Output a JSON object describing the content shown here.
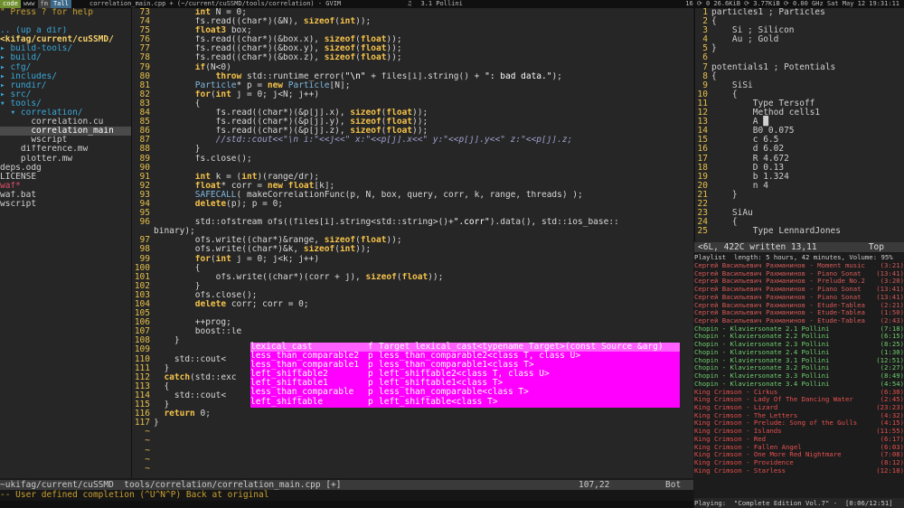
{
  "topbar": {
    "tags": [
      "code",
      "www",
      "fm",
      "Tall"
    ],
    "window_title": "correlation_main.cpp + (~/current/cuSSMD/tools/correlation) - GVIM",
    "now_playing": "3.1 Pollini",
    "status_right": "16  ⟳ 0  26.6KiB ⟳ 3.77KiB ⟳ 0.00 GHz  Sat May 12 19:31:11"
  },
  "tree": {
    "lines": [
      {
        "t": "\" Press ? for help",
        "c": "help"
      },
      {
        "t": "",
        "c": ""
      },
      {
        "t": ".. (up a dir)",
        "c": "dir"
      },
      {
        "t": "<kifag/current/cuSSMD/",
        "c": "cur"
      },
      {
        "t": "▸ build-tools/",
        "c": "dir"
      },
      {
        "t": "▸ build/",
        "c": "dir"
      },
      {
        "t": "▸ cfg/",
        "c": "dir"
      },
      {
        "t": "▸ includes/",
        "c": "dir"
      },
      {
        "t": "▸ rundir/",
        "c": "dir"
      },
      {
        "t": "▸ src/",
        "c": "dir"
      },
      {
        "t": "▾ tools/",
        "c": "dir"
      },
      {
        "t": "  ▾ correlation/",
        "c": "dir"
      },
      {
        "t": "      correlation.cu",
        "c": ""
      },
      {
        "t": "      correlation_main",
        "c": "hl"
      },
      {
        "t": "      wscript",
        "c": ""
      },
      {
        "t": "    difference.mw",
        "c": ""
      },
      {
        "t": "    plotter.mw",
        "c": ""
      },
      {
        "t": "deps.odg",
        "c": ""
      },
      {
        "t": "LICENSE",
        "c": ""
      },
      {
        "t": "waf*",
        "c": "red"
      },
      {
        "t": "waf.bat",
        "c": ""
      },
      {
        "t": "wscript",
        "c": ""
      }
    ]
  },
  "editor": {
    "lines": [
      {
        "n": "73",
        "h": "        int N = 0;"
      },
      {
        "n": "74",
        "h": "        fs.read((char*)(&N), sizeof(int));"
      },
      {
        "n": "75",
        "h": "        float3 box;"
      },
      {
        "n": "76",
        "h": "        fs.read((char*)(&box.x), sizeof(float));"
      },
      {
        "n": "77",
        "h": "        fs.read((char*)(&box.y), sizeof(float));"
      },
      {
        "n": "78",
        "h": "        fs.read((char*)(&box.z), sizeof(float));"
      },
      {
        "n": "79",
        "h": "        if(N<0)"
      },
      {
        "n": "80",
        "h": "            throw std::runtime_error(\"\\n\" + files[i].string() + \": bad data.\");"
      },
      {
        "n": "81",
        "h": "        Particle* p = new Particle[N];"
      },
      {
        "n": "82",
        "h": "        for(int j = 0; j<N; j++)"
      },
      {
        "n": "83",
        "h": "        {"
      },
      {
        "n": "84",
        "h": "            fs.read((char*)(&p[j].x), sizeof(float));"
      },
      {
        "n": "85",
        "h": "            fs.read((char*)(&p[j].y), sizeof(float));"
      },
      {
        "n": "86",
        "h": "            fs.read((char*)(&p[j].z), sizeof(float));"
      },
      {
        "n": "87",
        "h": "            //std::cout<<\"\\n i:\"<<j<<\" x:\"<<p[j].x<<\" y:\"<<p[j].y<<\" z:\"<<p[j].z;"
      },
      {
        "n": "88",
        "h": "        }"
      },
      {
        "n": "89",
        "h": "        fs.close();"
      },
      {
        "n": "90",
        "h": ""
      },
      {
        "n": "91",
        "h": "        int k = (int)(range/dr);"
      },
      {
        "n": "92",
        "h": "        float* corr = new float[k];"
      },
      {
        "n": "93",
        "h": "        SAFECALL( makeCorrelationFunc(p, N, box, query, corr, k, range, threads) );"
      },
      {
        "n": "94",
        "h": "        delete(p); p = 0;"
      },
      {
        "n": "95",
        "h": ""
      },
      {
        "n": "96",
        "h": "        std::ofstream ofs((files[i].string<std::string>()+\".corr\").data(), std::ios_base::"
      },
      {
        "n": "",
        "h": "binary);"
      },
      {
        "n": "97",
        "h": "        ofs.write((char*)&range, sizeof(float));"
      },
      {
        "n": "98",
        "h": "        ofs.write((char*)&k, sizeof(int));"
      },
      {
        "n": "99",
        "h": "        for(int j = 0; j<k; j++)"
      },
      {
        "n": "100",
        "h": "        {"
      },
      {
        "n": "101",
        "h": "            ofs.write((char*)(corr + j), sizeof(float));"
      },
      {
        "n": "102",
        "h": "        }"
      },
      {
        "n": "103",
        "h": "        ofs.close();"
      },
      {
        "n": "104",
        "h": "        delete corr; corr = 0;"
      },
      {
        "n": "105",
        "h": ""
      },
      {
        "n": "106",
        "h": "        ++prog;"
      },
      {
        "n": "107",
        "h": "        boost::le"
      },
      {
        "n": "108",
        "h": "    }"
      },
      {
        "n": "109",
        "h": ""
      },
      {
        "n": "110",
        "h": "    std::cout<"
      },
      {
        "n": "111",
        "h": "  }"
      },
      {
        "n": "112",
        "h": "  catch(std::exc"
      },
      {
        "n": "113",
        "h": "  {"
      },
      {
        "n": "114",
        "h": "    std::cout<"
      },
      {
        "n": "115",
        "h": "  }"
      },
      {
        "n": "116",
        "h": "  return 0;"
      },
      {
        "n": "117",
        "h": "}"
      },
      {
        "n": "~",
        "h": ""
      },
      {
        "n": "~",
        "h": ""
      },
      {
        "n": "~",
        "h": ""
      },
      {
        "n": "~",
        "h": ""
      },
      {
        "n": "~",
        "h": ""
      }
    ],
    "status_file": "~ukifag/current/cuSSMD  tools/correlation/correlation_main.cpp [+]",
    "status_pos": "107,22",
    "status_where": "Bot",
    "message": "-- User defined completion (^U^N^P) Back at original"
  },
  "popup": {
    "items": [
      {
        "w": "lexical_cast",
        "k": "f",
        "d": "Target lexical_cast<typename Target>(const Source &arg)"
      },
      {
        "w": "less_than_comparable2",
        "k": "p",
        "d": "less_than_comparable2<class T, class U>"
      },
      {
        "w": "less_than_comparable1",
        "k": "p",
        "d": "less_than_comparable1<class T>"
      },
      {
        "w": "left_shiftable2",
        "k": "p",
        "d": "left_shiftable2<class T, class U>"
      },
      {
        "w": "left_shiftable1",
        "k": "p",
        "d": "left_shiftable1<class T>"
      },
      {
        "w": "less_than_comparable",
        "k": "p",
        "d": "less_than_comparable<class T>"
      },
      {
        "w": "left_shiftable",
        "k": "p",
        "d": "left_shiftable<class T>"
      }
    ]
  },
  "rvim": {
    "lines": [
      {
        "n": "1",
        "t": "particles1 ; Particles"
      },
      {
        "n": "2",
        "t": "{"
      },
      {
        "n": "3",
        "t": "    Si ; Silicon"
      },
      {
        "n": "4",
        "t": "    Au ; Gold"
      },
      {
        "n": "5",
        "t": "}"
      },
      {
        "n": "6",
        "t": ""
      },
      {
        "n": "7",
        "t": "potentials1 ; Potentials"
      },
      {
        "n": "8",
        "t": "{"
      },
      {
        "n": "9",
        "t": "    SiSi"
      },
      {
        "n": "10",
        "t": "    {"
      },
      {
        "n": "11",
        "t": "        Type Tersoff"
      },
      {
        "n": "12",
        "t": "        Method cells1"
      },
      {
        "n": "13",
        "t": "        A █"
      },
      {
        "n": "14",
        "t": "        B0 0.075"
      },
      {
        "n": "15",
        "t": "        c 6.5"
      },
      {
        "n": "16",
        "t": "        d 6.02"
      },
      {
        "n": "17",
        "t": "        R 4.672"
      },
      {
        "n": "18",
        "t": "        D 0.13"
      },
      {
        "n": "19",
        "t": "        b 1.324"
      },
      {
        "n": "20",
        "t": "        n 4"
      },
      {
        "n": "21",
        "t": "    }"
      },
      {
        "n": "22",
        "t": ""
      },
      {
        "n": "23",
        "t": "    SiAu"
      },
      {
        "n": "24",
        "t": "    {"
      },
      {
        "n": "25",
        "t": "        Type LennardJones"
      }
    ],
    "status_left": "<6L, 422C written 13,11",
    "status_right": "Top"
  },
  "playlist": {
    "header": "Playlist  length: 5 hours, 42 minutes, Volume: 95%",
    "rows": [
      {
        "a": "Сергей Васильевич Рахманинов - Moment music",
        "d": "(3:21)",
        "c": "ru"
      },
      {
        "a": "Сергей Васильевич Рахманинов - Piano Sonat",
        "d": "(13:41)",
        "c": "ru"
      },
      {
        "a": "Сергей Васильевич Рахманинов - Prelude No.2",
        "d": "(3:20)",
        "c": "ru"
      },
      {
        "a": "Сергей Васильевич Рахманинов - Piano Sonat",
        "d": "(13:41)",
        "c": "ru"
      },
      {
        "a": "Сергей Васильевич Рахманинов - Piano Sonat",
        "d": "(13:41)",
        "c": "ru"
      },
      {
        "a": "Сергей Васильевич Рахманинов - Etude-Tablea",
        "d": "(2:21)",
        "c": "ru"
      },
      {
        "a": "Сергей Васильевич Рахманинов - Etude-Tablea",
        "d": "(1:50)",
        "c": "ru"
      },
      {
        "a": "Сергей Васильевич Рахманинов - Etude-Tablea",
        "d": "(2:43)",
        "c": "ru"
      },
      {
        "a": "Chopin - Klaviersonate 2.1 Pollini",
        "d": "(7:18)",
        "c": ""
      },
      {
        "a": "Chopin - Klaviersonate 2.2 Pollini",
        "d": "(6:15)",
        "c": ""
      },
      {
        "a": "Chopin - Klaviersonate 2.3 Pollini",
        "d": "(8:25)",
        "c": ""
      },
      {
        "a": "Chopin - Klaviersonate 2.4 Pollini",
        "d": "(1:30)",
        "c": ""
      },
      {
        "a": "Chopin - Klaviersonate 3.1 Pollini",
        "d": "(12:51)",
        "c": ""
      },
      {
        "a": "Chopin - Klaviersonate 3.2 Pollini",
        "d": "(2:27)",
        "c": ""
      },
      {
        "a": "Chopin - Klaviersonate 3.3 Pollini",
        "d": "(8:49)",
        "c": ""
      },
      {
        "a": "Chopin - Klaviersonate 3.4 Pollini",
        "d": "(4:54)",
        "c": ""
      },
      {
        "a": "King Crimson - Cirkus",
        "d": "(6:30)",
        "c": "kc"
      },
      {
        "a": "King Crimson - Lady Of The Dancing Water",
        "d": "(2:45)",
        "c": "kc"
      },
      {
        "a": "King Crimson - Lizard",
        "d": "(23:23)",
        "c": "kc"
      },
      {
        "a": "King Crimson - The Letters",
        "d": "(4:32)",
        "c": "kc"
      },
      {
        "a": "King Crimson - Prelude: Song of the Gulls",
        "d": "(4:15)",
        "c": "kc"
      },
      {
        "a": "King Crimson - Islands",
        "d": "(11:55)",
        "c": "kc"
      },
      {
        "a": "King Crimson - Red",
        "d": "(6:17)",
        "c": "kc"
      },
      {
        "a": "King Crimson - Fallen Angel",
        "d": "(6:03)",
        "c": "kc"
      },
      {
        "a": "King Crimson - One More Red Nightmare",
        "d": "(7:08)",
        "c": "kc"
      },
      {
        "a": "King Crimson - Providence",
        "d": "(8:12)",
        "c": "kc"
      },
      {
        "a": "King Crimson - Starless",
        "d": "(12:18)",
        "c": "kc"
      }
    ],
    "playing": "Playing:  \"Complete Edition Vol.7\" -  [0:06/12:51]"
  }
}
